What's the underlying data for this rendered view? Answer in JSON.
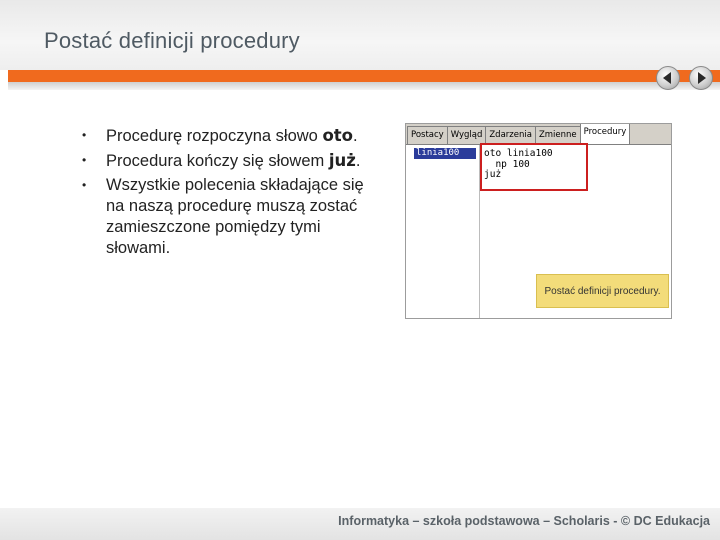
{
  "slide": {
    "title": "Postać definicji procedury",
    "bullets": [
      {
        "text": "Procedurę rozpoczyna słowo ",
        "keyword": "oto",
        "suffix": "."
      },
      {
        "text": "Procedura kończy się słowem ",
        "keyword": "już",
        "suffix": "."
      },
      {
        "text": "Wszystkie polecenia składające się na naszą procedurę muszą zostać zamieszczone pomiędzy tymi słowami.",
        "keyword": "",
        "suffix": ""
      }
    ],
    "bullet_glyph": "•"
  },
  "screenshot": {
    "tabs": [
      "Postacy",
      "Wygląd",
      "Zdarzenia",
      "Zmienne",
      "Procedury"
    ],
    "active_tab": "Procedury",
    "list_item": "linia100",
    "code_lines": [
      "oto linia100",
      "  np 100",
      "już"
    ],
    "tooltip": "Postać definicji procedury.",
    "highlight_color": "#cc1f1f"
  },
  "navigation": {
    "prev_icon": "arrow-left-icon",
    "next_icon": "arrow-right-icon"
  },
  "footer": {
    "text": "Informatyka – szkoła podstawowa – Scholaris - © DC Edukacja"
  },
  "colors": {
    "accent": "#f06a1e",
    "title": "#4f5a63"
  }
}
